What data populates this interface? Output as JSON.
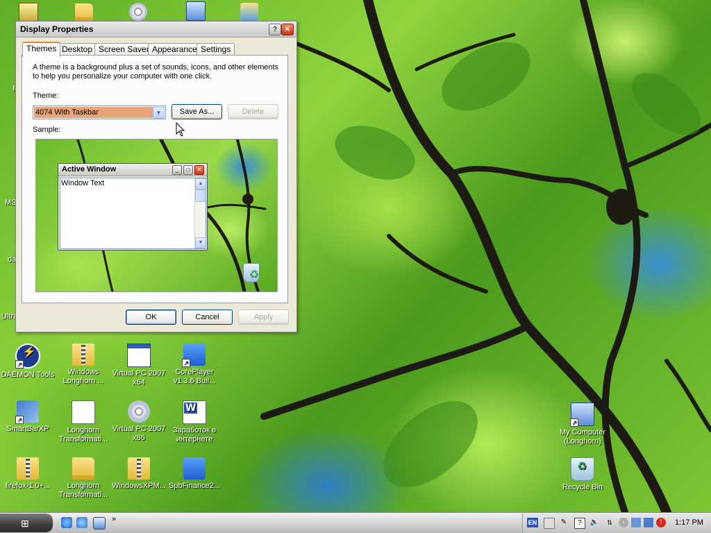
{
  "dialog": {
    "title": "Display Properties",
    "tabs": [
      "Themes",
      "Desktop",
      "Screen Saver",
      "Appearance",
      "Settings"
    ],
    "active_tab": "Themes",
    "description": "A theme is a background plus a set of sounds, icons, and other elements to help you personalize your computer with one click.",
    "theme_label": "Theme:",
    "theme_value": "4074 With Taskbar",
    "save_as_label": "Save As...",
    "delete_label": "Delete",
    "sample_label": "Sample:",
    "sample_window_title": "Active Window",
    "sample_window_text": "Window Text",
    "ok_label": "OK",
    "cancel_label": "Cancel",
    "apply_label": "Apply"
  },
  "desktop": {
    "partial_labels": [
      "M",
      "MS",
      "da",
      "Ultra"
    ],
    "icons": [
      {
        "label": "DAEMON Tools",
        "icon": "daemon-tools-icon"
      },
      {
        "label": "Windows Longhorn ...",
        "icon": "zip-folder-icon"
      },
      {
        "label": "Virtual PC 2007 x64",
        "icon": "application-window-icon"
      },
      {
        "label": "CorePlayer v1.3.6 Buil...",
        "icon": "coreplayer-icon"
      },
      {
        "label": "SmartBarXP",
        "icon": "smartbarxp-icon"
      },
      {
        "label": "Longhorn Transformati...",
        "icon": "7zip-archive-icon"
      },
      {
        "label": "Virtual PC 2007 x86",
        "icon": "cd-disc-icon"
      },
      {
        "label": "Заработок в интернете",
        "icon": "word-document-icon"
      },
      {
        "label": "firefox-1.0+...",
        "icon": "zip-folder-icon"
      },
      {
        "label": "Longhorn Transformati...",
        "icon": "folder-icon"
      },
      {
        "label": "WindowsXPM...",
        "icon": "zip-folder-icon"
      },
      {
        "label": "SpbFinance2...",
        "icon": "spbfinance-icon"
      },
      {
        "label": "My Computer (Longhorn)",
        "icon": "my-computer-icon"
      },
      {
        "label": "Recycle Bin",
        "icon": "recycle-bin-icon"
      }
    ]
  },
  "taskbar": {
    "language": "EN",
    "clock": "1:17 PM",
    "quick_launch": [
      "ie-icon",
      "ie-alt-icon",
      "show-desktop-icon"
    ],
    "overflow_chevron": "»"
  },
  "colors": {
    "dialog_bg": "#ece9d8",
    "selected_theme_bg": "#e8a378",
    "active_tab_accent": "#e68b2c",
    "close_red": "#c9321a"
  }
}
